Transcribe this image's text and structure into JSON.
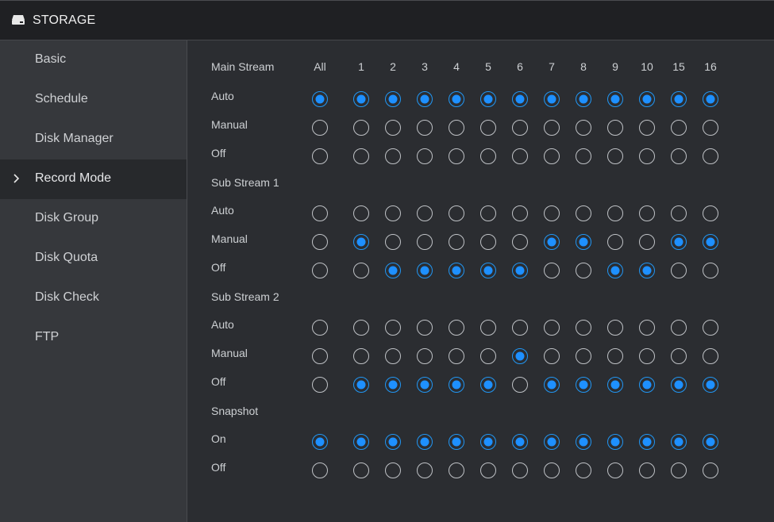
{
  "header": {
    "title": "STORAGE",
    "icon": "hard-drive-icon"
  },
  "sidebar": {
    "items": [
      {
        "label": "Basic",
        "active": false
      },
      {
        "label": "Schedule",
        "active": false
      },
      {
        "label": "Disk Manager",
        "active": false
      },
      {
        "label": "Record Mode",
        "active": true
      },
      {
        "label": "Disk Group",
        "active": false
      },
      {
        "label": "Disk Quota",
        "active": false
      },
      {
        "label": "Disk Check",
        "active": false
      },
      {
        "label": "FTP",
        "active": false
      }
    ]
  },
  "columns": [
    "All",
    "1",
    "2",
    "3",
    "4",
    "5",
    "6",
    "7",
    "8",
    "9",
    "10",
    "15",
    "16"
  ],
  "sections": [
    {
      "title": "Main Stream",
      "options": [
        {
          "label": "Auto",
          "selected": [
            1,
            1,
            1,
            1,
            1,
            1,
            1,
            1,
            1,
            1,
            1,
            1,
            1
          ]
        },
        {
          "label": "Manual",
          "selected": [
            0,
            0,
            0,
            0,
            0,
            0,
            0,
            0,
            0,
            0,
            0,
            0,
            0
          ]
        },
        {
          "label": "Off",
          "selected": [
            0,
            0,
            0,
            0,
            0,
            0,
            0,
            0,
            0,
            0,
            0,
            0,
            0
          ]
        }
      ]
    },
    {
      "title": "Sub Stream 1",
      "options": [
        {
          "label": "Auto",
          "selected": [
            0,
            0,
            0,
            0,
            0,
            0,
            0,
            0,
            0,
            0,
            0,
            0,
            0
          ]
        },
        {
          "label": "Manual",
          "selected": [
            0,
            1,
            0,
            0,
            0,
            0,
            0,
            1,
            1,
            0,
            0,
            1,
            1
          ]
        },
        {
          "label": "Off",
          "selected": [
            0,
            0,
            1,
            1,
            1,
            1,
            1,
            0,
            0,
            1,
            1,
            0,
            0
          ]
        }
      ]
    },
    {
      "title": "Sub Stream 2",
      "options": [
        {
          "label": "Auto",
          "selected": [
            0,
            0,
            0,
            0,
            0,
            0,
            0,
            0,
            0,
            0,
            0,
            0,
            0
          ]
        },
        {
          "label": "Manual",
          "selected": [
            0,
            0,
            0,
            0,
            0,
            0,
            1,
            0,
            0,
            0,
            0,
            0,
            0
          ]
        },
        {
          "label": "Off",
          "selected": [
            0,
            1,
            1,
            1,
            1,
            1,
            0,
            1,
            1,
            1,
            1,
            1,
            1
          ]
        }
      ]
    },
    {
      "title": "Snapshot",
      "options": [
        {
          "label": "On",
          "selected": [
            1,
            1,
            1,
            1,
            1,
            1,
            1,
            1,
            1,
            1,
            1,
            1,
            1
          ]
        },
        {
          "label": "Off",
          "selected": [
            0,
            0,
            0,
            0,
            0,
            0,
            0,
            0,
            0,
            0,
            0,
            0,
            0
          ]
        }
      ]
    }
  ],
  "colors": {
    "accent": "#1e90ff",
    "ring": "#bfc2c6"
  }
}
